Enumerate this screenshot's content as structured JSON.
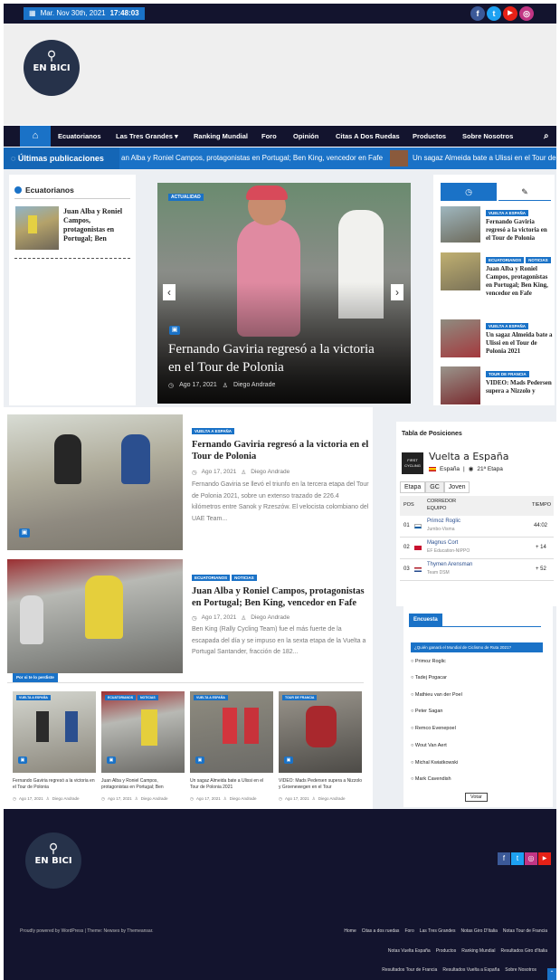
{
  "topbar": {
    "date": "Mar. Nov 30th, 2021",
    "time": "17:48:03",
    "social": [
      {
        "icon": "facebook-icon",
        "glyph": "f",
        "color": "#3b5998"
      },
      {
        "icon": "twitter-icon",
        "glyph": "t",
        "color": "#1da1f2"
      },
      {
        "icon": "youtube-icon",
        "glyph": "▶",
        "color": "#e62117"
      },
      {
        "icon": "instagram-icon",
        "glyph": "◎",
        "color": "#c13584"
      }
    ]
  },
  "logo": {
    "text": "EN BICI"
  },
  "nav": {
    "items": [
      "Ecuatorianos",
      "Las Tres Grandes ▾",
      "Ranking Mundial",
      "Foro",
      "Opinión",
      "Citas A Dos Ruedas",
      "Productos",
      "Sobre Nosotros"
    ]
  },
  "ticker": {
    "label": "Últimas publicaciones",
    "item1": "an Alba y Roniel Campos, protagonistas en Portugal; Ben King, vencedor en Fafe",
    "item2": "Un sagaz Almeida bate a Ulissi en el Tour de P"
  },
  "left_widget": {
    "heading": "Ecuatorianos",
    "post_title": "Juan Alba y Roniel Campos, protagonistas en Portugal; Ben"
  },
  "slider": {
    "badge": "ACTUALIDAD",
    "title": "Fernando Gaviria regresó a la victoria en el Tour de Polonia",
    "date": "Ago 17, 2021",
    "author": "Diego Andrade",
    "prev": "‹",
    "next": "›"
  },
  "right_tabs": {
    "tab1_icon": "◷",
    "tab2_icon": "✎",
    "posts": [
      {
        "badges": [
          "VUELTA A ESPAÑA"
        ],
        "title": "Fernando Gaviria regresó a la victoria en el Tour de Polonia"
      },
      {
        "badges": [
          "ECUATORIANOS",
          "NOTICIAS"
        ],
        "title": "Juan Alba y Roniel Campos, protagonistas en Portugal; Ben King, vencedor en Fafe"
      },
      {
        "badges": [
          "VUELTA A ESPAÑA"
        ],
        "title": "Un sagaz Almeida bate a Ulissi en el Tour de Polonia 2021"
      },
      {
        "badges": [
          "TOUR DE FRANCIA"
        ],
        "title": "VIDEO: Mads Pedersen supera a Nizzolo y"
      }
    ]
  },
  "articles": [
    {
      "badges": [
        "VUELTA A ESPAÑA"
      ],
      "title": "Fernando Gaviria regresó a la victoria en el Tour de Polonia",
      "date": "Ago 17, 2021",
      "author": "Diego Andrade",
      "excerpt": "Fernando Gaviria se llevó el triunfo en la tercera etapa del Tour de Polonia 2021, sobre un extenso trazado de 226.4 kilómetros entre Sanok y Rzeszów. El velocista colombiano del UAE Team..."
    },
    {
      "badges": [
        "ECUATORIANOS",
        "NOTICIAS"
      ],
      "title": "Juan Alba y Roniel Campos, protagonistas en Portugal; Ben King, vencedor en Fafe",
      "date": "Ago 17, 2021",
      "author": "Diego Andrade",
      "excerpt": "Ben King (Rally Cycling Team) fue el más fuerte de la escapada del día y se impuso en la sexta etapa de la Vuelta a Portugal Santander, fracción de 182..."
    }
  ],
  "standings": {
    "heading": "Tabla de Posiciones",
    "race": "Vuelta a España",
    "country": "España",
    "stage": "21ª Etapa",
    "logo_text": "FIRST CYCLING",
    "tabs": [
      "Etapa",
      "GC",
      "Joven"
    ],
    "col_pos": "POS",
    "col_rider": "CORREDOR",
    "col_team": "EQUIPO",
    "col_time": "TIEMPO",
    "rows": [
      {
        "pos": "01",
        "rider": "Primoz Roglic",
        "team": "Jumbo-Visma",
        "time": "44:02",
        "flag": "#ffffff"
      },
      {
        "pos": "02",
        "rider": "Magnus Cort",
        "team": "EF Education-NIPPO",
        "time": "+ 14",
        "flag": "#c8102e"
      },
      {
        "pos": "03",
        "rider": "Thymen Arensman",
        "team": "Team DSM",
        "time": "+ 52",
        "flag": "#21468b"
      }
    ]
  },
  "poll": {
    "heading": "Encuesta",
    "question": "¿Quién ganará el Mundial de Ciclismo de Ruta 2021?",
    "options": [
      "Primoz Roglic",
      "Tadej Pogacar",
      "Mathieu van der Poel",
      "Peter Sagan",
      "Remco Evenepoel",
      "Wout Van Aert",
      "Michal Kwiatkowski",
      "Mark Cavendish"
    ],
    "button": "Votar"
  },
  "missed": {
    "heading": "Por si te lo perdiste",
    "cards": [
      {
        "badges": [
          "VUELTA A ESPAÑA"
        ],
        "title": "Fernando Gaviria regresó a la victoria en el Tour de Polonia",
        "date": "Ago 17, 2021",
        "author": "Diego Andrade"
      },
      {
        "badges": [
          "ECUATORIANOS",
          "NOTICIAS"
        ],
        "title": "Juan Alba y Roniel Campos, protagonistas en Portugal; Ben",
        "date": "Ago 17, 2021",
        "author": "Diego Andrade"
      },
      {
        "badges": [
          "VUELTA A ESPAÑA"
        ],
        "title": "Un sagaz Almeida bate a Ulissi en el Tour de Polonia 2021",
        "date": "Ago 17, 2021",
        "author": "Diego Andrade"
      },
      {
        "badges": [
          "TOUR DE FRANCIA"
        ],
        "title": "VIDEO: Mads Pedersen supera a Nizzolo y Groenewegen en el Tour",
        "date": "Ago 17, 2021",
        "author": "Diego Andrade"
      }
    ]
  },
  "footer": {
    "credit": "Proudly powered by WordPress | Theme: Newses by Themeansar.",
    "links_row1": [
      "Home",
      "Citas a dos ruedas",
      "Foro",
      "Las Tres Grandes",
      "Notas Giro D'Italia",
      "Notas Tour de Francia"
    ],
    "links_row2": [
      "Notas Vuelta España",
      "Productos",
      "Ranking Mundial",
      "Resultados Giro d'Italia"
    ],
    "links_row3": [
      "Resultados Tour de Francia",
      "Resultados Vuelta a España",
      "Sobre Nosotros"
    ]
  }
}
